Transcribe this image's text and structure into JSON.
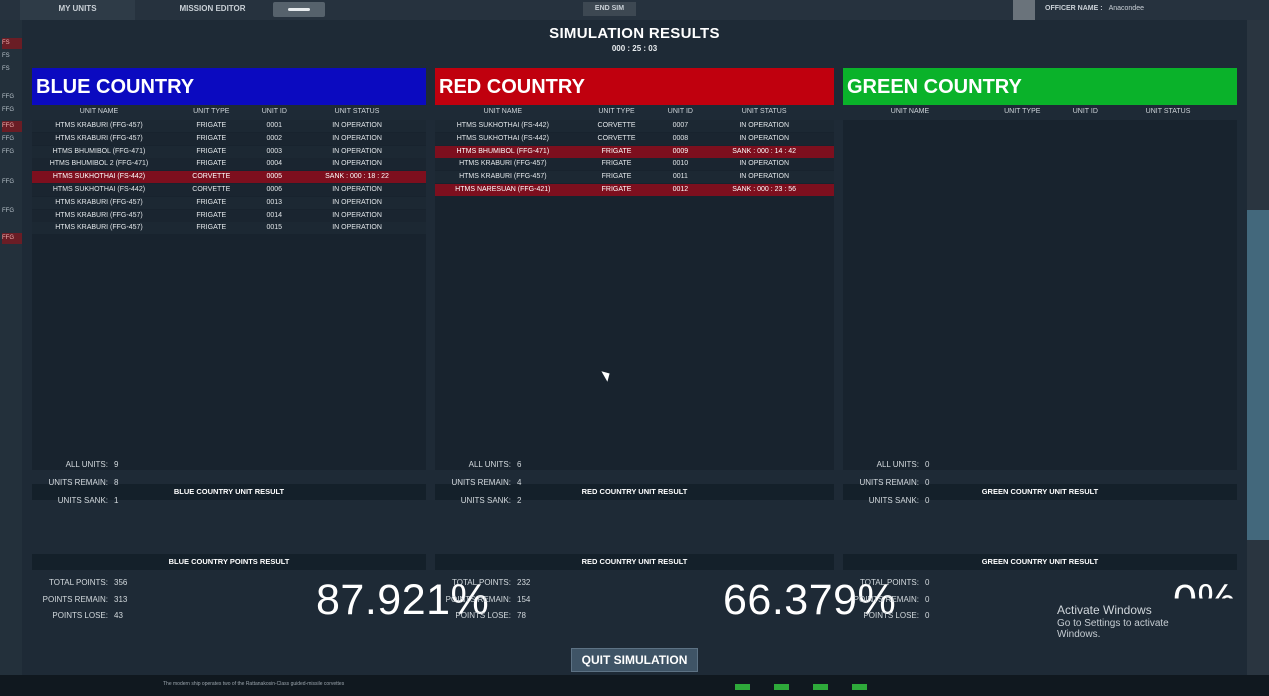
{
  "topbar": {
    "my_units": "MY UNITS",
    "mission_editor": "MISSION EDITOR",
    "end_sim": "END SIM",
    "officer_label": "OFFICER NAME :",
    "officer_name": "Anacondee"
  },
  "left_strip": [
    "FS",
    "FS",
    "FS",
    "FFG",
    "FFG",
    "FFG",
    "FFG",
    "FFG",
    "FFG",
    "FFG",
    "FFG"
  ],
  "modal": {
    "title": "SIMULATION RESULTS",
    "timer": "000 : 25 : 03",
    "columns_headers": [
      "UNIT NAME",
      "UNIT TYPE",
      "UNIT ID",
      "UNIT STATUS"
    ],
    "blue": {
      "name": "BLUE COUNTRY",
      "color": "#0b0ac0",
      "units": [
        {
          "name": "HTMS KRABURI (FFG-457)",
          "type": "FRIGATE",
          "id": "0001",
          "status": "IN OPERATION",
          "sank": false
        },
        {
          "name": "HTMS KRABURI (FFG-457)",
          "type": "FRIGATE",
          "id": "0002",
          "status": "IN OPERATION",
          "sank": false
        },
        {
          "name": "HTMS BHUMIBOL (FFG-471)",
          "type": "FRIGATE",
          "id": "0003",
          "status": "IN OPERATION",
          "sank": false
        },
        {
          "name": "HTMS BHUMIBOL 2 (FFG-471)",
          "type": "FRIGATE",
          "id": "0004",
          "status": "IN OPERATION",
          "sank": false
        },
        {
          "name": "HTMS SUKHOTHAI (FS-442)",
          "type": "CORVETTE",
          "id": "0005",
          "status": "SANK : 000 : 18 : 22",
          "sank": true
        },
        {
          "name": "HTMS SUKHOTHAI (FS-442)",
          "type": "CORVETTE",
          "id": "0006",
          "status": "IN OPERATION",
          "sank": false
        },
        {
          "name": "HTMS KRABURI (FFG-457)",
          "type": "FRIGATE",
          "id": "0013",
          "status": "IN OPERATION",
          "sank": false
        },
        {
          "name": "HTMS KRABURI (FFG-457)",
          "type": "FRIGATE",
          "id": "0014",
          "status": "IN OPERATION",
          "sank": false
        },
        {
          "name": "HTMS KRABURI (FFG-457)",
          "type": "FRIGATE",
          "id": "0015",
          "status": "IN OPERATION",
          "sank": false
        }
      ],
      "unit_result_title": "BLUE COUNTRY UNIT RESULT",
      "all_units_label": "ALL UNITS:",
      "all_units": "9",
      "units_remain_label": "UNITS REMAIN:",
      "units_remain": "8",
      "units_sank_label": "UNITS SANK:",
      "units_sank": "1",
      "points_result_title": "BLUE COUNTRY POINTS RESULT",
      "total_points_label": "TOTAL POINTS:",
      "total_points": "356",
      "points_remain_label": "POINTS REMAIN:",
      "points_remain": "313",
      "points_lose_label": "POINTS LOSE:",
      "points_lose": "43",
      "percent": "87.921%"
    },
    "red": {
      "name": "RED COUNTRY",
      "color": "#c0000e",
      "units": [
        {
          "name": "HTMS SUKHOTHAI (FS-442)",
          "type": "CORVETTE",
          "id": "0007",
          "status": "IN OPERATION",
          "sank": false
        },
        {
          "name": "HTMS SUKHOTHAI (FS-442)",
          "type": "CORVETTE",
          "id": "0008",
          "status": "IN OPERATION",
          "sank": false
        },
        {
          "name": "HTMS BHUMIBOL (FFG-471)",
          "type": "FRIGATE",
          "id": "0009",
          "status": "SANK : 000 : 14 : 42",
          "sank": true
        },
        {
          "name": "HTMS KRABURI (FFG-457)",
          "type": "FRIGATE",
          "id": "0010",
          "status": "IN OPERATION",
          "sank": false
        },
        {
          "name": "HTMS KRABURI (FFG-457)",
          "type": "FRIGATE",
          "id": "0011",
          "status": "IN OPERATION",
          "sank": false
        },
        {
          "name": "HTMS NARESUAN (FFG-421)",
          "type": "FRIGATE",
          "id": "0012",
          "status": "SANK : 000 : 23 : 56",
          "sank": true
        }
      ],
      "unit_result_title": "RED COUNTRY UNIT RESULT",
      "all_units_label": "ALL UNITS:",
      "all_units": "6",
      "units_remain_label": "UNITS REMAIN:",
      "units_remain": "4",
      "units_sank_label": "UNITS SANK:",
      "units_sank": "2",
      "points_result_title": "RED COUNTRY UNIT RESULT",
      "total_points_label": "TOTAL POINTS:",
      "total_points": "232",
      "points_remain_label": "POINTS REMAIN:",
      "points_remain": "154",
      "points_lose_label": "POINTS LOSE:",
      "points_lose": "78",
      "percent": "66.379%"
    },
    "green": {
      "name": "GREEN COUNTRY",
      "color": "#0ab22a",
      "units": [],
      "unit_result_title": "GREEN COUNTRY UNIT RESULT",
      "all_units_label": "ALL UNITS:",
      "all_units": "0",
      "units_remain_label": "UNITS REMAIN:",
      "units_remain": "0",
      "units_sank_label": "UNITS SANK:",
      "units_sank": "0",
      "points_result_title": "GREEN COUNTRY UNIT RESULT",
      "total_points_label": "TOTAL POINTS:",
      "total_points": "0",
      "points_remain_label": "POINTS REMAIN:",
      "points_remain": "0",
      "points_lose_label": "POINTS LOSE:",
      "points_lose": "0",
      "percent": "0%"
    },
    "quit_label": "QUIT SIMULATION"
  },
  "bottom_caption": "The modern ship operates two of the Rattanakosin-Class guided-missile corvettes",
  "activate_windows": {
    "title": "Activate Windows",
    "subtitle": "Go to Settings to activate Windows."
  }
}
